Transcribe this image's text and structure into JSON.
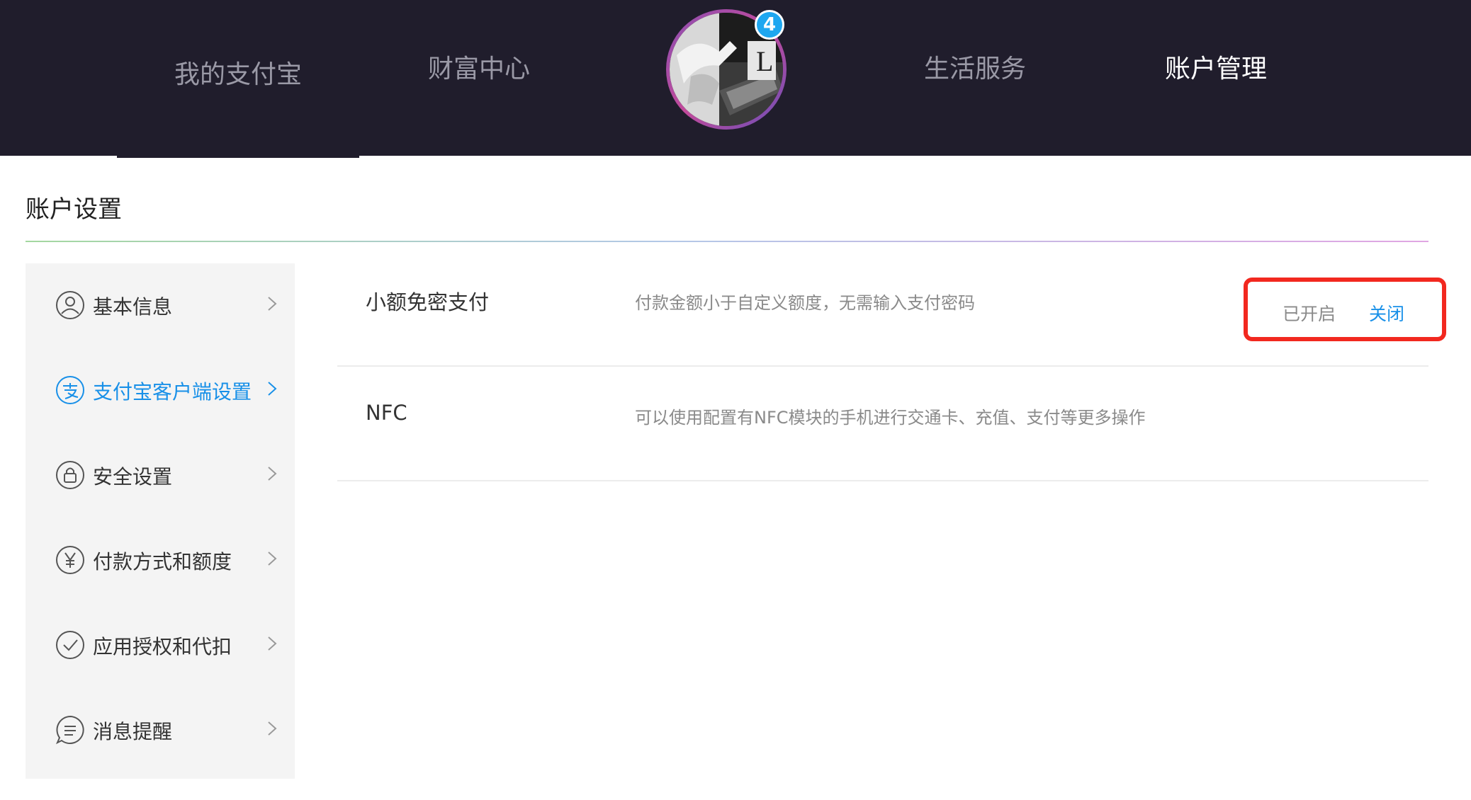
{
  "nav": {
    "items": [
      {
        "label": "我的支付宝"
      },
      {
        "label": "财富中心"
      },
      {
        "label": "生活服务"
      },
      {
        "label": "账户管理"
      }
    ],
    "badge_count": "4",
    "active_color": "#ffffff",
    "inactive_color": "#9a99a6"
  },
  "page": {
    "title": "账户设置"
  },
  "sidebar": {
    "items": [
      {
        "label": "基本信息",
        "icon": "user-icon"
      },
      {
        "label": "支付宝客户端设置",
        "icon": "alipay-icon"
      },
      {
        "label": "安全设置",
        "icon": "lock-icon"
      },
      {
        "label": "付款方式和额度",
        "icon": "yen-icon"
      },
      {
        "label": "应用授权和代扣",
        "icon": "check-icon"
      },
      {
        "label": "消息提醒",
        "icon": "message-icon"
      }
    ],
    "active_color": "#1890e8"
  },
  "settings": {
    "rows": [
      {
        "name": "小额免密支付",
        "desc": "付款金额小于自定义额度，无需输入支付密码",
        "status": "已开启",
        "action": "关闭"
      },
      {
        "name": "NFC",
        "desc": "可以使用配置有NFC模块的手机进行交通卡、充值、支付等更多操作"
      }
    ]
  },
  "colors": {
    "topbar": "#201d2c",
    "accent": "#1890e8",
    "highlight": "#f2281f"
  }
}
